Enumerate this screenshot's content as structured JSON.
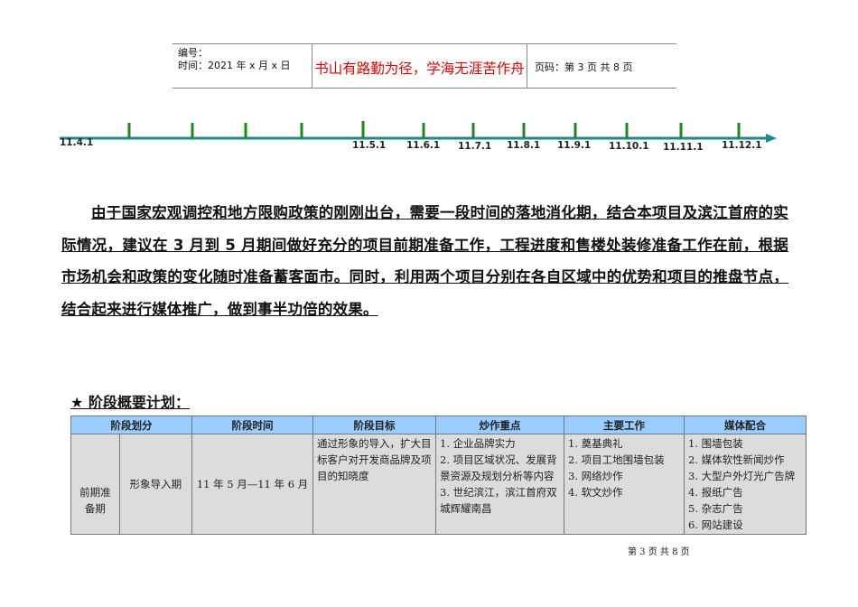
{
  "header": {
    "number_label": "编号：",
    "time_label": "时间：2021 年 x 月 x 日",
    "motto": "书山有路勤为径，学海无涯苦作舟",
    "page_label": "页码：第 3 页  共 8 页"
  },
  "timeline": {
    "start_label": "11.4.1",
    "labels": [
      "11.5.1",
      "11.6.1",
      "11.7.1",
      "11.8.1",
      "11.9.1",
      "11.10.1",
      "11.11.1",
      "11.12.1"
    ],
    "line_color": "#1a8a8a",
    "tick_color": "#1a8a1a"
  },
  "paragraph": {
    "text": "由于国家宏观调控和地方限购政策的刚刚出台，需要一段时间的落地消化期，结合本项目及滨江首府的实际情况，建议在 3 月到 5 月期间做好充分的项目前期准备工作，工程进度和售楼处装修准备工作在前，根据市场机会和政策的变化随时准备蓄客面市。同时，利用两个项目分别在各自区域中的优势和项目的推盘节点，结合起来进行媒体推广，做到事半功倍的效果。"
  },
  "section": {
    "title": "★ 阶段概要计划："
  },
  "table": {
    "headers": [
      "阶段划分",
      "阶段时间",
      "阶段目标",
      "炒作重点",
      "主要工作",
      "媒体配合"
    ],
    "row": {
      "phase": "前期准备期",
      "stage": "形象导入期",
      "time": "11 年 5 月—11 年 6 月",
      "goal": "通过形象的导入，扩大目标客户对开发商品牌及项目的知晓度",
      "focus": [
        "1. 企业品牌实力",
        "2. 项目区域状况、发展背景资源及规划分析等内容",
        "3. 世纪滨江，滨江首府双城辉耀南昌"
      ],
      "work": [
        "1. 奠基典礼",
        "2. 项目工地围墙包装",
        "3. 网络炒作",
        "4. 软文炒作"
      ],
      "media": [
        "1. 围墙包装",
        "2. 媒体软性新闻炒作",
        "3. 大型户外灯光广告牌",
        "4. 报纸广告",
        "5. 杂志广告",
        "6. 网站建设"
      ]
    }
  },
  "footer": {
    "text": "第 3 页 共 8 页"
  }
}
